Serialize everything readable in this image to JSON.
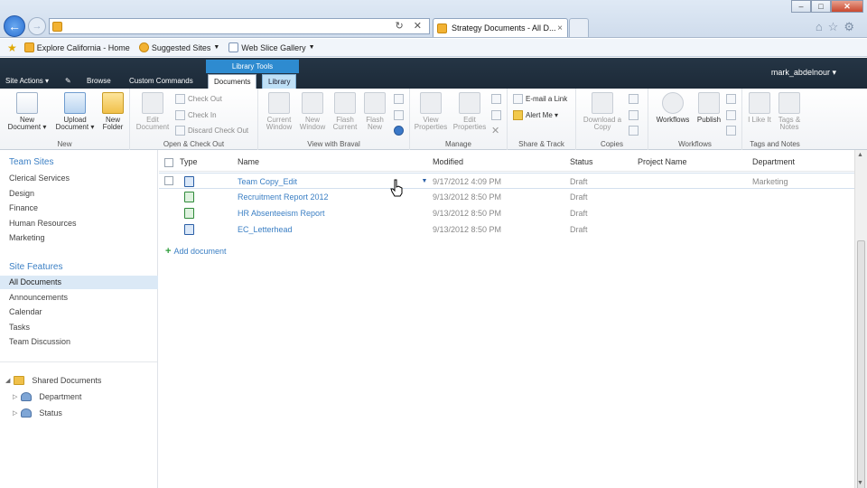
{
  "browser": {
    "tab_title": "Strategy Documents - All D...",
    "tab_close": "×",
    "address_icons": "↻ ✕",
    "win_min": "–",
    "win_max": "□",
    "win_close": "✕",
    "tools": "⌂☆⚙"
  },
  "favorites": {
    "items": [
      {
        "label": "Explore California - Home"
      },
      {
        "label": "Suggested Sites"
      },
      {
        "label": "Web Slice Gallery"
      }
    ]
  },
  "sp": {
    "context_group": "Library Tools",
    "tabs": {
      "site_actions": "Site Actions",
      "browse": "Browse",
      "custom_commands": "Custom Commands",
      "documents": "Documents",
      "library": "Library"
    },
    "user": "mark_abdelnour"
  },
  "ribbon": {
    "new_label": "New",
    "new_document": "New Document",
    "upload_document": "Upload Document",
    "new_folder": "New Folder",
    "edit_document": "Edit Document",
    "check_out": "Check Out",
    "check_in": "Check In",
    "discard_check_out": "Discard Check Out",
    "open_check_out_label": "Open & Check Out",
    "current_window": "Current Window",
    "new_window": "New Window",
    "flash_current": "Flash Current",
    "flash_new": "Flash New",
    "view_with_braval_label": "View with Braval",
    "view_properties": "View Properties",
    "edit_properties": "Edit Properties",
    "manage_label": "Manage",
    "email_link": "E-mail a Link",
    "alert_me": "Alert Me",
    "share_track_label": "Share & Track",
    "download_copy": "Download a Copy",
    "copies_label": "Copies",
    "workflows": "Workflows",
    "publish": "Publish",
    "workflows_label": "Workflows",
    "i_like_it": "I Like It",
    "tags_notes": "Tags & Notes",
    "tags_notes_label": "Tags and Notes"
  },
  "leftnav": {
    "team_sites": "Team Sites",
    "sites": [
      "Clerical Services",
      "Design",
      "Finance",
      "Human Resources",
      "Marketing"
    ],
    "site_features": "Site Features",
    "features": [
      "All Documents",
      "Announcements",
      "Calendar",
      "Tasks",
      "Team Discussion"
    ],
    "tree": {
      "root": "Shared Documents",
      "children": [
        "Department",
        "Status"
      ]
    }
  },
  "list": {
    "headers": {
      "type": "Type",
      "name": "Name",
      "modified": "Modified",
      "status": "Status",
      "project": "Project Name",
      "department": "Department"
    },
    "rows": [
      {
        "name": "Team Copy_Edit",
        "modified": "9/17/2012 4:09 PM",
        "status": "Draft",
        "department": "Marketing",
        "type": "word"
      },
      {
        "name": "Recruitment Report 2012",
        "modified": "9/13/2012 8:50 PM",
        "status": "Draft",
        "department": "",
        "type": "excel"
      },
      {
        "name": "HR Absenteeism Report",
        "modified": "9/13/2012 8:50 PM",
        "status": "Draft",
        "department": "",
        "type": "excel"
      },
      {
        "name": "EC_Letterhead",
        "modified": "9/13/2012 8:50 PM",
        "status": "Draft",
        "department": "",
        "type": "word"
      }
    ],
    "add_document": "Add document"
  }
}
